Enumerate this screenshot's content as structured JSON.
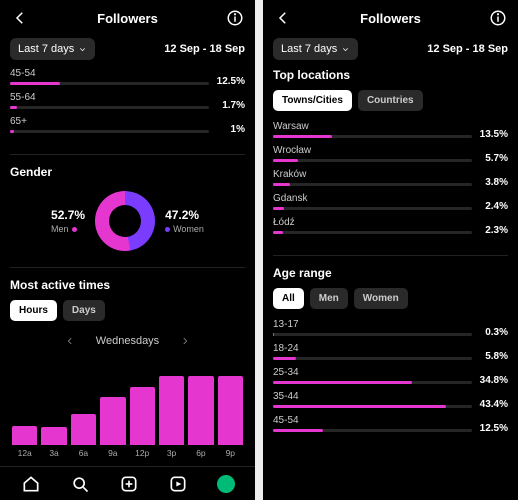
{
  "header": {
    "title": "Followers",
    "dropdown_label": "Last 7 days",
    "date_range": "12 Sep - 18 Sep"
  },
  "left": {
    "age_partial": [
      {
        "label": "45-54",
        "pct": 12.5,
        "pct_label": "12.5%"
      },
      {
        "label": "55-64",
        "pct": 1.7,
        "pct_label": "1.7%"
      },
      {
        "label": "65+",
        "pct": 1.0,
        "pct_label": "1%"
      }
    ],
    "gender": {
      "title": "Gender",
      "men_pct": 52.7,
      "men_label": "52.7%",
      "men_word": "Men",
      "women_pct": 47.2,
      "women_label": "47.2%",
      "women_word": "Women",
      "men_color": "#e536d0",
      "women_color": "#7a3cff"
    },
    "active": {
      "title": "Most active times",
      "tabs": [
        "Hours",
        "Days"
      ],
      "active_tab": 0,
      "day_label": "Wednesdays"
    }
  },
  "right": {
    "locations": {
      "title": "Top locations",
      "tabs": [
        "Towns/Cities",
        "Countries"
      ],
      "active_tab": 0,
      "items": [
        {
          "label": "Warsaw",
          "pct": 13.5,
          "pct_label": "13.5%"
        },
        {
          "label": "Wrocław",
          "pct": 5.7,
          "pct_label": "5.7%"
        },
        {
          "label": "Kraków",
          "pct": 3.8,
          "pct_label": "3.8%"
        },
        {
          "label": "Gdansk",
          "pct": 2.4,
          "pct_label": "2.4%"
        },
        {
          "label": "Łódź",
          "pct": 2.3,
          "pct_label": "2.3%"
        }
      ]
    },
    "age": {
      "title": "Age range",
      "tabs": [
        "All",
        "Men",
        "Women"
      ],
      "active_tab": 0,
      "items": [
        {
          "label": "13-17",
          "pct": 0.3,
          "pct_label": "0.3%"
        },
        {
          "label": "18-24",
          "pct": 5.8,
          "pct_label": "5.8%"
        },
        {
          "label": "25-34",
          "pct": 34.8,
          "pct_label": "34.8%"
        },
        {
          "label": "35-44",
          "pct": 43.4,
          "pct_label": "43.4%"
        },
        {
          "label": "45-54",
          "pct": 12.5,
          "pct_label": "12.5%"
        }
      ]
    }
  },
  "chart_data": {
    "type": "bar",
    "title": "Most active times — Wednesdays",
    "categories": [
      "12a",
      "3a",
      "6a",
      "9a",
      "12p",
      "3p",
      "6p",
      "9p"
    ],
    "values": [
      22,
      21,
      36,
      56,
      67,
      80,
      80,
      80
    ],
    "ylim": [
      0,
      100
    ],
    "note": "relative activity, unlabeled y-axis; values estimated from bar heights"
  }
}
